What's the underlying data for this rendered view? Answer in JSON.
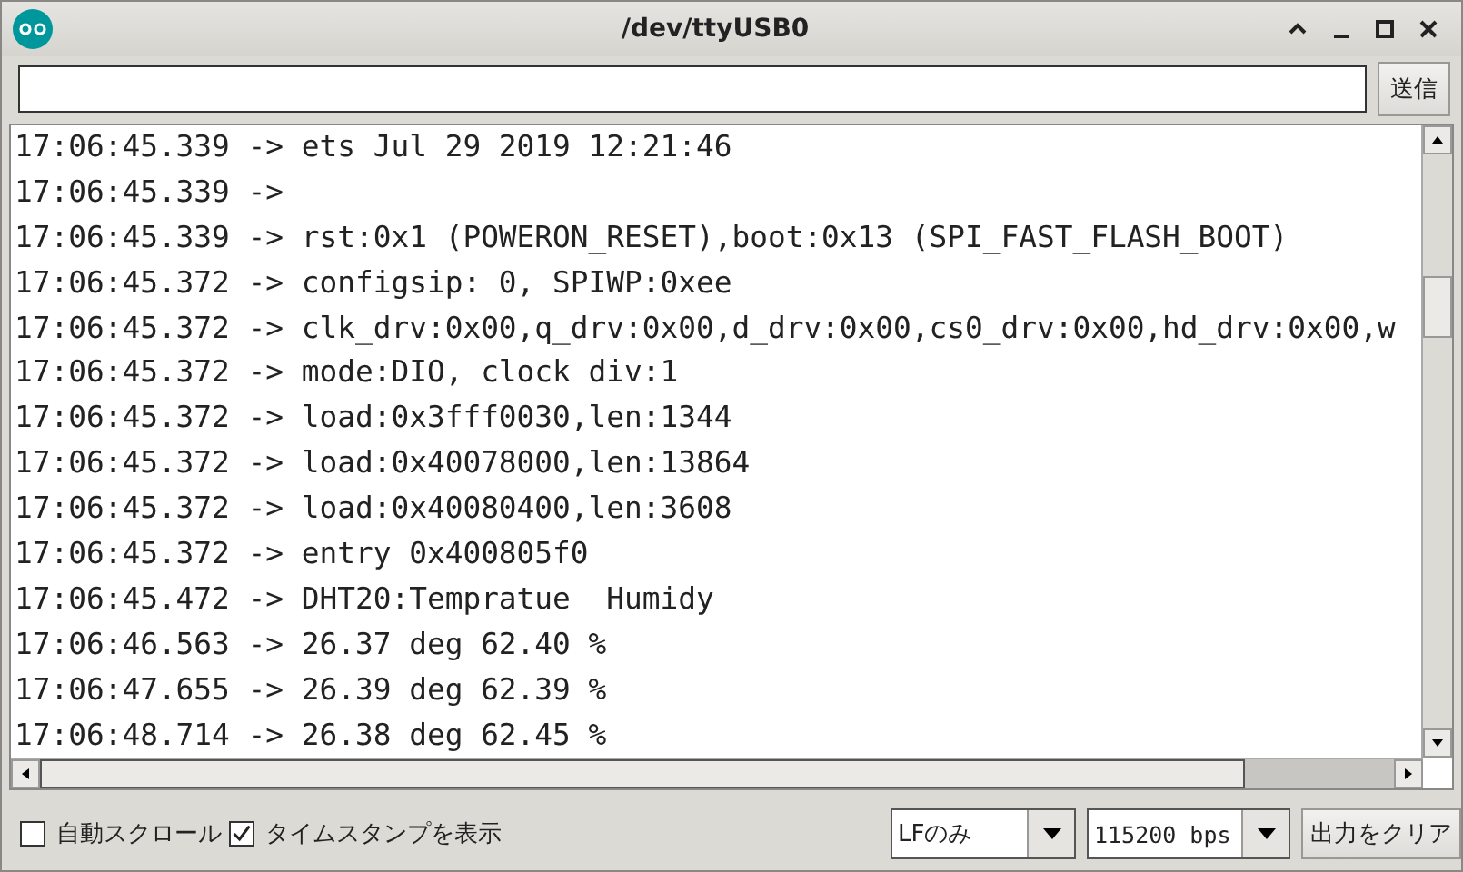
{
  "window": {
    "title": "/dev/ttyUSB0"
  },
  "input": {
    "button": "送信"
  },
  "output_lines": [
    "17:06:45.339 -> ets Jul 29 2019 12:21:46",
    "17:06:45.339 ->",
    "17:06:45.339 -> rst:0x1 (POWERON_RESET),boot:0x13 (SPI_FAST_FLASH_BOOT)",
    "17:06:45.372 -> configsip: 0, SPIWP:0xee",
    "17:06:45.372 -> clk_drv:0x00,q_drv:0x00,d_drv:0x00,cs0_drv:0x00,hd_drv:0x00,w",
    "17:06:45.372 -> mode:DIO, clock div:1",
    "17:06:45.372 -> load:0x3fff0030,len:1344",
    "17:06:45.372 -> load:0x40078000,len:13864",
    "17:06:45.372 -> load:0x40080400,len:3608",
    "17:06:45.372 -> entry 0x400805f0",
    "17:06:45.472 -> DHT20:Tempratue  Humidy",
    "17:06:46.563 -> 26.37 deg 62.40 %",
    "17:06:47.655 -> 26.39 deg 62.39 %",
    "17:06:48.714 -> 26.38 deg 62.45 %"
  ],
  "options": [
    {
      "label": "自動スクロール",
      "checked": false
    },
    {
      "label": "タイムスタンプを表示",
      "checked": true
    }
  ],
  "line_ending": "LFのみ",
  "baud_rate": "115200 bps",
  "clear_button": "出力をクリア"
}
